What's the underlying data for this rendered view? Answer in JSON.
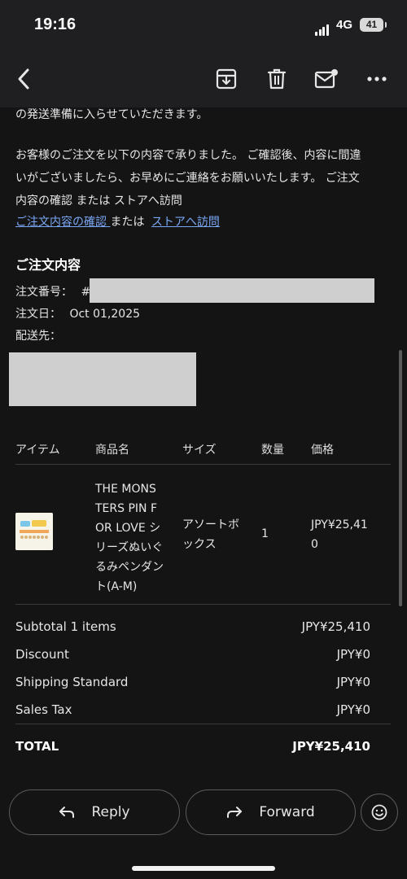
{
  "status_bar": {
    "time": "19:16",
    "network": "4G",
    "battery": "41"
  },
  "toolbar": {
    "icons": [
      "back-arrow-icon",
      "archive-icon",
      "trash-icon",
      "mark-unread-icon",
      "more-icon"
    ]
  },
  "email": {
    "intro_fragment": "の発送準備に入らせていただきます。",
    "paragraph_line1": "お客様のご注文を以下の内容で承りました。 ご確認後、内容に間違",
    "paragraph_line2": "いがございましたら、お早めにご連絡をお願いいたします。 ご注文",
    "paragraph_line3": "内容の確認 または ストアへ訪問",
    "link_confirm": "ご注文内容の確認 ",
    "link_or": "または",
    "link_store": "ストアへ訪問",
    "order_heading": "ご注文内容",
    "order_number_label": "注文番号：",
    "order_number_prefix": "#",
    "order_date_label": "注文日：",
    "order_date": "Oct 01,2025",
    "ship_to_label": "配送先："
  },
  "table": {
    "headers": [
      "アイテム",
      "商品名",
      "サイズ",
      "数量",
      "価格"
    ],
    "rows": [
      {
        "name_lines": [
          "THE MONS",
          "TERS PIN F",
          "OR LOVE シ",
          "リーズぬいぐ",
          "るみペンダン",
          "ト(A-M)"
        ],
        "size_lines": [
          "アソートボ",
          "ックス"
        ],
        "qty": "1",
        "price_lines": [
          "JPY¥25,41",
          "0"
        ]
      }
    ]
  },
  "summary": [
    {
      "label": "Subtotal 1 items",
      "value": "JPY¥25,410"
    },
    {
      "label": "Discount",
      "value": "JPY¥0"
    },
    {
      "label": "Shipping Standard",
      "value": "JPY¥0"
    },
    {
      "label": "Sales Tax",
      "value": "JPY¥0"
    }
  ],
  "total": {
    "label": "TOTAL",
    "value": "JPY¥25,410"
  },
  "actions": {
    "reply": "Reply",
    "forward": "Forward"
  },
  "colors": {
    "background": "#141414",
    "bar": "#1f1f21",
    "link": "#7aa7f5"
  }
}
